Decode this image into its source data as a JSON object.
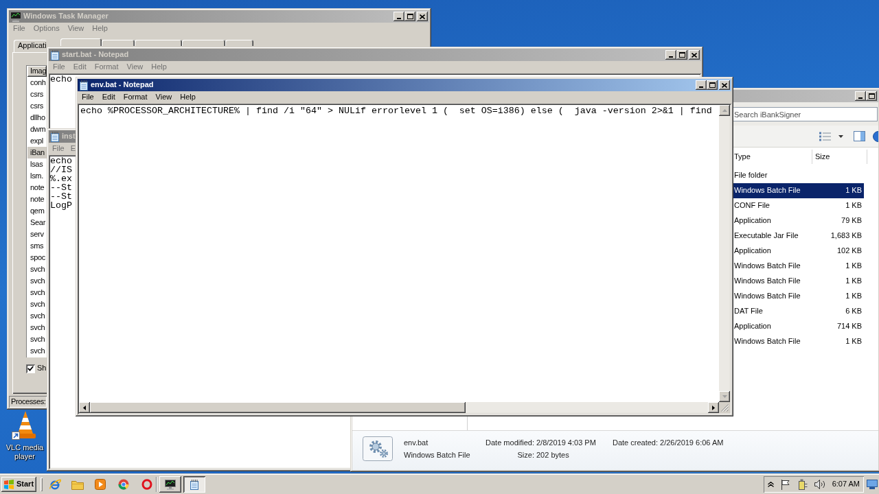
{
  "task_manager": {
    "title": "Windows Task Manager",
    "active": false,
    "menu": [
      "File",
      "Options",
      "View",
      "Help"
    ],
    "tabs": [
      {
        "label": "Applicati",
        "selected": false
      },
      {
        "selected": true
      },
      {
        "selected": false
      },
      {
        "selected": false
      },
      {
        "selected": false
      },
      {
        "selected": false
      }
    ],
    "process_list": {
      "header": "Imag",
      "rows": [
        {
          "name": "conh",
          "selected": false
        },
        {
          "name": "csrs",
          "selected": false
        },
        {
          "name": "csrs",
          "selected": false
        },
        {
          "name": "dllho",
          "selected": false
        },
        {
          "name": "dwm",
          "selected": false
        },
        {
          "name": "expl",
          "selected": false
        },
        {
          "name": "iBan",
          "selected": true
        },
        {
          "name": "lsas",
          "selected": false
        },
        {
          "name": "lsm.",
          "selected": false
        },
        {
          "name": "note",
          "selected": false
        },
        {
          "name": "note",
          "selected": false
        },
        {
          "name": "qem",
          "selected": false
        },
        {
          "name": "Sear",
          "selected": false
        },
        {
          "name": "serv",
          "selected": false
        },
        {
          "name": "sms",
          "selected": false
        },
        {
          "name": "spoc",
          "selected": false
        },
        {
          "name": "svch",
          "selected": false
        },
        {
          "name": "svch",
          "selected": false
        },
        {
          "name": "svch",
          "selected": false
        },
        {
          "name": "svch",
          "selected": false
        },
        {
          "name": "svch",
          "selected": false
        },
        {
          "name": "svch",
          "selected": false
        },
        {
          "name": "svch",
          "selected": false
        },
        {
          "name": "svch",
          "selected": false
        }
      ]
    },
    "show_all": {
      "label": "Sh",
      "checked": true
    },
    "status": "Processes:"
  },
  "start_notepad": {
    "title": "start.bat - Notepad",
    "active": false,
    "menu": [
      "File",
      "Edit",
      "Format",
      "View",
      "Help"
    ],
    "lines": [
      "echo"
    ]
  },
  "env_notepad": {
    "title": "env.bat - Notepad",
    "active": true,
    "menu": [
      "File",
      "Edit",
      "Format",
      "View",
      "Help"
    ],
    "lines": [
      "echo %PROCESSOR_ARCHITECTURE% | find /i \"64\" > NULif errorlevel 1 (  set OS=i386) else (  java -version 2>&1 | find"
    ]
  },
  "install_notepad": {
    "title": "inst",
    "active": false,
    "menu": [
      "File",
      "E"
    ],
    "lines": [
      "echo",
      "//IS",
      "%.ex",
      "--St",
      "--St",
      "LogP"
    ]
  },
  "explorer": {
    "active": false,
    "search": {
      "placeholder": "Search iBankSigner"
    },
    "columns": [
      "Type",
      "Size"
    ],
    "rows": [
      {
        "type": "File folder",
        "selected": false
      },
      {
        "type": "Windows Batch File",
        "size": "1 KB",
        "selected": true
      },
      {
        "type": "CONF File",
        "size": "1 KB",
        "selected": false
      },
      {
        "type": "Application",
        "size": "79 KB",
        "selected": false
      },
      {
        "type": "Executable Jar File",
        "size": "1,683 KB",
        "selected": false
      },
      {
        "type": "Application",
        "size": "102 KB",
        "selected": false
      },
      {
        "type": "Windows Batch File",
        "size": "1 KB",
        "selected": false
      },
      {
        "type": "Windows Batch File",
        "size": "1 KB",
        "selected": false
      },
      {
        "type": "Windows Batch File",
        "size": "1 KB",
        "selected": false
      },
      {
        "type": "DAT File",
        "size": "6 KB",
        "selected": false
      },
      {
        "type": "Application",
        "size": "714 KB",
        "selected": false
      },
      {
        "type": "Windows Batch File",
        "size": "1 KB",
        "selected": false
      }
    ],
    "details": {
      "name": "env.bat",
      "type": "Windows Batch File",
      "fields": [
        {
          "label": "Date modified:",
          "value": "2/8/2019 4:03 PM"
        },
        {
          "label": "Size:",
          "value": "202 bytes"
        },
        {
          "label": "Date created:",
          "value": "2/26/2019 6:06 AM"
        }
      ]
    }
  },
  "desktop": {
    "shortcut_label": "VLC media player"
  },
  "taskbar": {
    "start": "Start",
    "task_buttons": [
      {
        "kind": "taskmanager",
        "selected": false
      },
      {
        "kind": "notepad",
        "selected": true
      }
    ],
    "clock": "6:07 AM"
  }
}
